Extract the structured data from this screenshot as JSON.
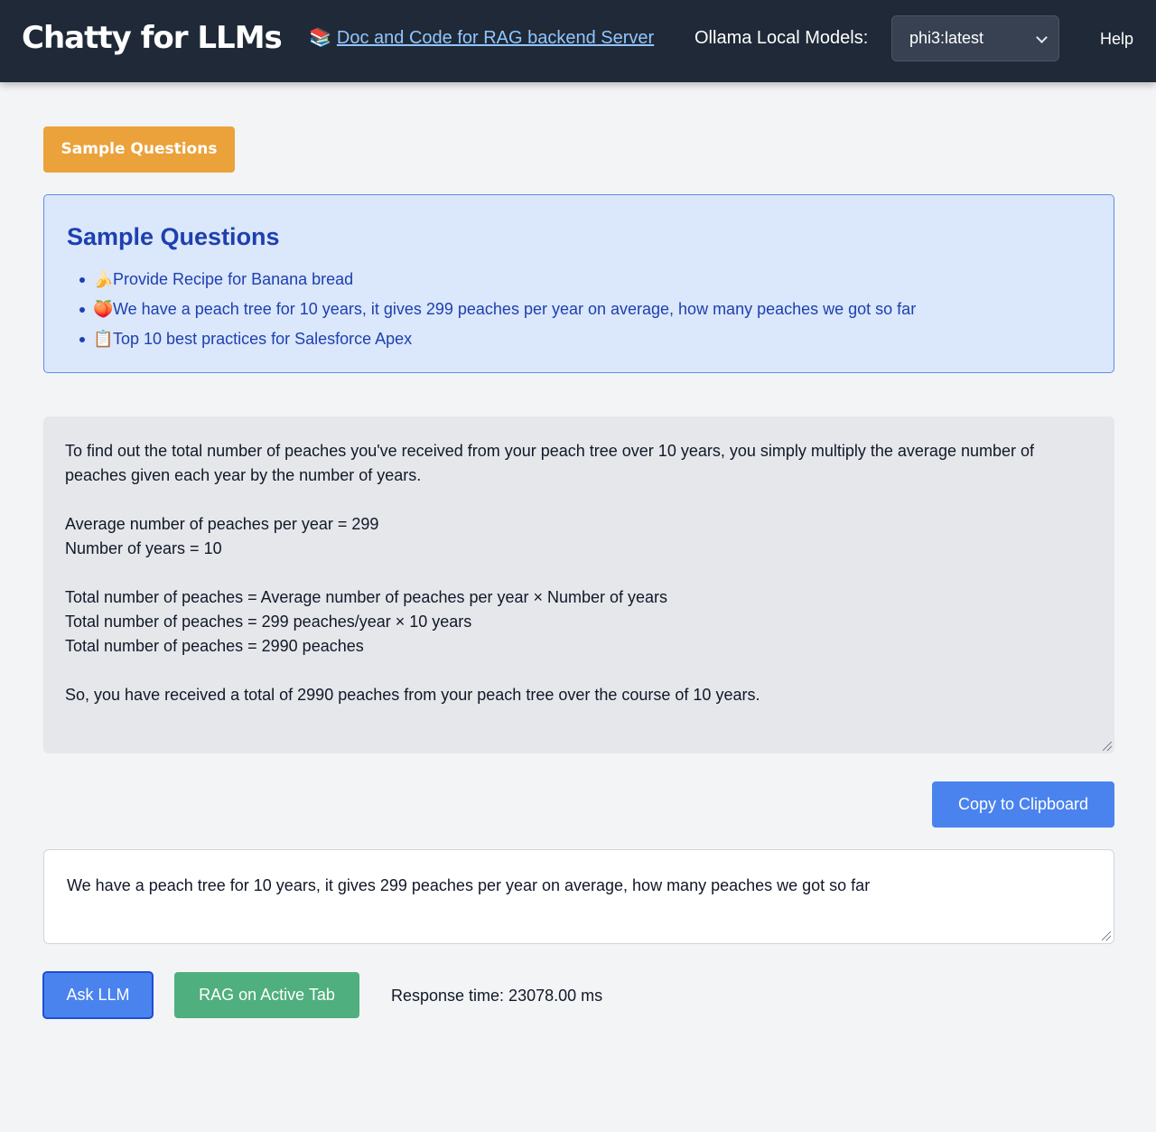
{
  "header": {
    "title": "Chatty for LLMs",
    "doc_link_icon": "📚",
    "doc_link_text": "Doc and Code for RAG backend Server",
    "models_label": "Ollama Local Models:",
    "model_selected": "phi3:latest",
    "help_label": "Help"
  },
  "sample_questions": {
    "button_label": "Sample Questions",
    "title": "Sample Questions",
    "items": [
      {
        "icon": "🍌",
        "text": "Provide Recipe for Banana bread"
      },
      {
        "icon": "🍑",
        "text": "We have a peach tree for 10 years, it gives 299 peaches per year on average, how many peaches we got so far"
      },
      {
        "icon": "📋",
        "text": "Top 10 best practices for Salesforce Apex"
      }
    ]
  },
  "response": {
    "text": "To find out the total number of peaches you've received from your peach tree over 10 years, you simply multiply the average number of peaches given each year by the number of years.\n\nAverage number of peaches per year = 299\nNumber of years = 10\n\nTotal number of peaches = Average number of peaches per year × Number of years\nTotal number of peaches = 299 peaches/year × 10 years\nTotal number of peaches = 2990 peaches\n\nSo, you have received a total of 2990 peaches from your peach tree over the course of 10 years.",
    "copy_label": "Copy to Clipboard"
  },
  "prompt": {
    "value": "We have a peach tree for 10 years, it gives 299 peaches per year on average, how many peaches we got so far"
  },
  "actions": {
    "ask_label": "Ask LLM",
    "rag_label": "RAG on Active Tab",
    "response_time": "Response time: 23078.00 ms"
  },
  "colors": {
    "header_bg": "#1f2937",
    "accent_orange": "#eba23a",
    "accent_blue": "#4a83ee",
    "accent_green": "#4faf7e",
    "link_blue": "#1e40af"
  }
}
